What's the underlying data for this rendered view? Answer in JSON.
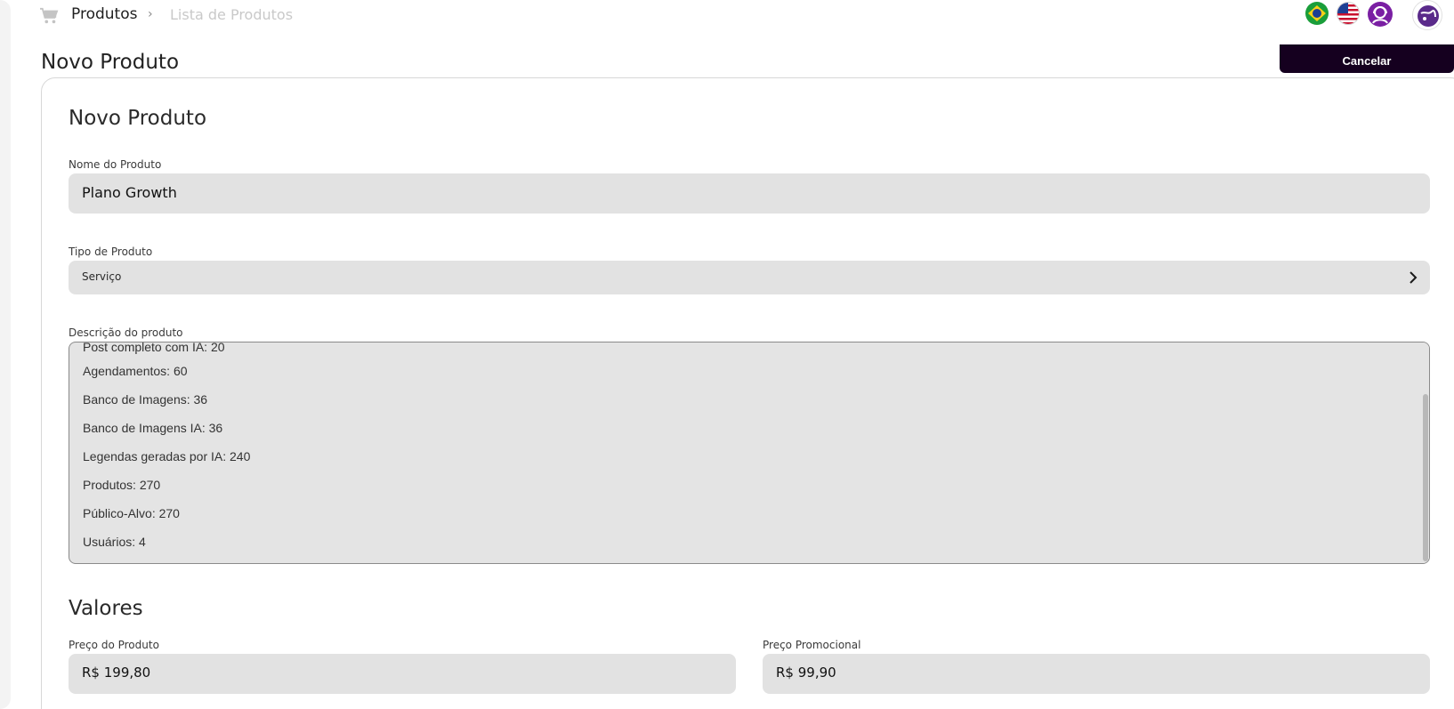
{
  "breadcrumb": {
    "main": "Produtos",
    "separator": "›",
    "sub": "Lista de Produtos"
  },
  "header": {
    "page_title": "Novo Produto",
    "cancel_label": "Cancelar",
    "icons": [
      "cart-icon",
      "brazil-flag-icon",
      "us-flag-icon",
      "support-icon",
      "avatar"
    ]
  },
  "form": {
    "section_title": "Novo Produto",
    "name_label": "Nome do Produto",
    "name_value": "Plano Growth",
    "type_label": "Tipo de Produto",
    "type_value": "Serviço",
    "description_label": "Descrição do produto",
    "description_lines": [
      "Post completo com IA: 20",
      "Agendamentos: 60",
      "Banco de Imagens: 36",
      "Banco de Imagens IA: 36",
      "Legendas geradas por IA: 240",
      "Produtos: 270",
      "Público-Alvo: 270",
      "Usuários: 4"
    ],
    "values_title": "Valores",
    "price_label": "Preço do Produto",
    "price_value": "R$ 199,80",
    "promo_label": "Preço Promocional",
    "promo_value": "R$ 99,90"
  },
  "colors": {
    "accent": "#15001f",
    "input_bg": "#e2e2e2",
    "support_purple": "#7a1fa3"
  }
}
